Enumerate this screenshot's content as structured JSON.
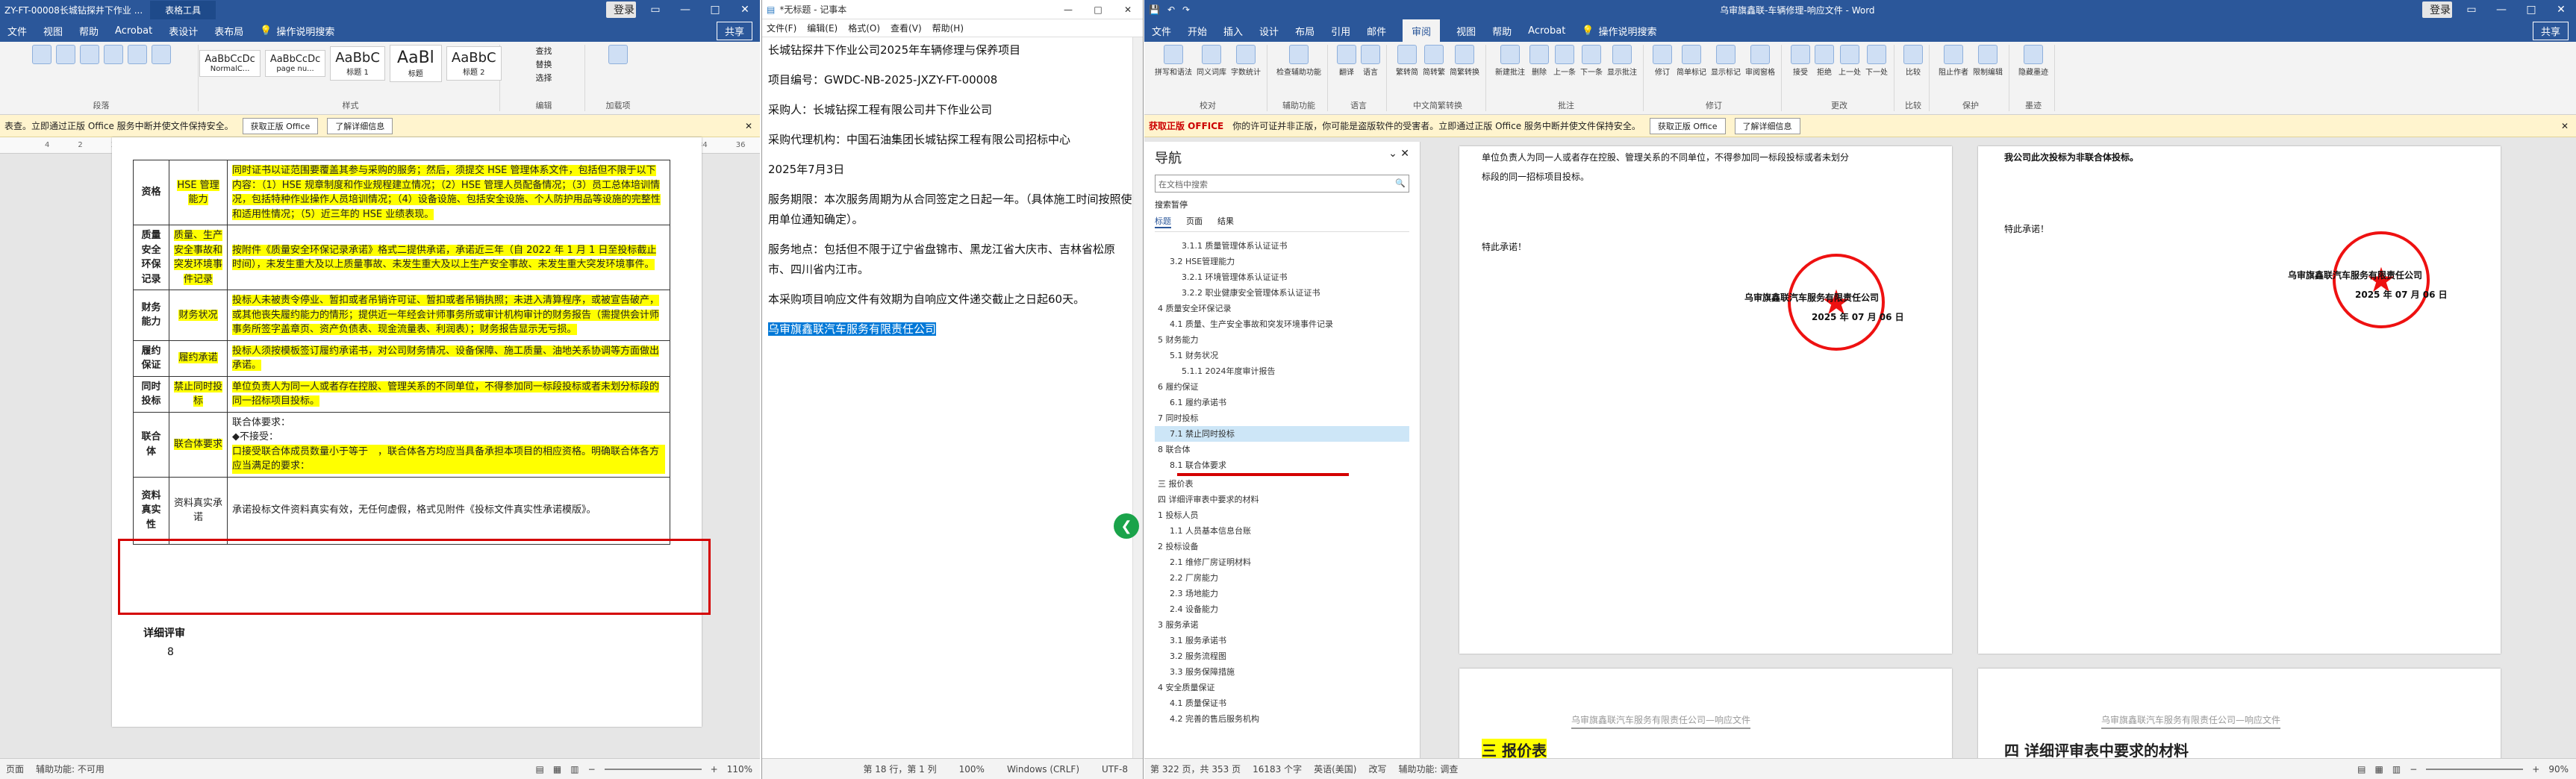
{
  "word1": {
    "title": "ZY-FT-00008长城钻探井下作业 ...",
    "context_tab": "表格工具",
    "signin": "登录",
    "tabs": [
      "文件",
      "视图",
      "帮助",
      "Acrobat",
      "表设计",
      "表布局"
    ],
    "tell_me": "操作说明搜索",
    "share": "共享",
    "ribbon_groups": [
      "段落",
      "样式",
      "编辑",
      "加载项"
    ],
    "styles": [
      {
        "sample": "AaBbCcDc",
        "name": "NormalC..."
      },
      {
        "sample": "AaBbCcDc",
        "name": "page nu..."
      },
      {
        "sample": "AaBbC",
        "name": "标题 1"
      },
      {
        "sample": "AaBl",
        "name": "标题"
      },
      {
        "sample": "AaBbC",
        "name": "标题 2"
      }
    ],
    "edit_items": [
      "查找",
      "替换",
      "选择"
    ],
    "msgbar": {
      "text": "表查。立即通过正版 Office 服务中断并使文件保持安全。",
      "btn1": "获取正版 Office",
      "btn2": "了解详细信息"
    },
    "table_rows": [
      {
        "c1": "资格",
        "c2": "HSE 管理能力",
        "c3": "同时证书以证范围要覆盖其参与采购的服务；然后，须提交 HSE 管理体系文件，包括但不限于以下内容：（1）HSE 规章制度和作业规程建立情况；（2）HSE 管理人员配备情况；（3）员工总体培训情况，包括特种作业操作人员培训情况；（4）设备设施、包括安全设施、个人防护用品等设施的完整性和适用性情况；（5）近三年的 HSE 业绩表现。"
      },
      {
        "c1": "质量安全环保记录",
        "c2": "质量、生产安全事故和突发环境事件记录",
        "c3": "按附件《质量安全环保记录承诺》格式二提供承诺，承诺近三年（自 2022 年 1 月 1 日至投标截止时间），未发生重大及以上质量事故、未发生重大及以上生产安全事故、未发生重大突发环境事件。"
      },
      {
        "c1": "财务能力",
        "c2": "财务状况",
        "c3": "投标人未被责令停业、暂扣或者吊销许可证、暂扣或者吊销执照；未进入清算程序，或被宣告破产，或其他丧失履约能力的情形；提供近一年经会计师事务所或审计机构审计的财务报告（需提供会计师事务所签字盖章页、资产负债表、现金流量表、利润表）；财务报告显示无亏损。"
      },
      {
        "c1": "履约保证",
        "c2": "履约承诺",
        "c3": "投标人须按模板签订履约承诺书，对公司财务情况、设备保障、施工质量、油地关系协调等方面做出承诺。"
      },
      {
        "c1": "同时投标",
        "c2": "禁止同时投标",
        "c3": "单位负责人为同一人或者存在控股、管理关系的不同单位，不得参加同一标段投标或者未划分标段的同一招标项目投标。"
      },
      {
        "c1": "联合体",
        "c2": "联合体要求",
        "c3a": "联合体要求：",
        "c3b": "◆不接受：",
        "c3c": "口接受联合体成员数量小于等于　，联合体各方均应当具备承担本项目的相应资格。明确联合体各方应当满足的要求："
      },
      {
        "c1": "资料真实性",
        "c2": "资料真实承诺",
        "c3": "承诺投标文件资料真实有效，无任何虚假，格式见附件《投标文件真实性承诺模版》。"
      }
    ],
    "below_table": "详细评审",
    "page_num": "8",
    "status_left": [
      "页面",
      "辅助功能: 不可用"
    ],
    "zoom": "110%"
  },
  "notepad": {
    "title": "*无标题 - 记事本",
    "menu": [
      "文件(F)",
      "编辑(E)",
      "格式(O)",
      "查看(V)",
      "帮助(H)"
    ],
    "lines": [
      "长城钻探井下作业公司2025年车辆修理与保养项目",
      "项目编号：GWDC-NB-2025-JXZY-FT-00008",
      "采购人：长城钻探工程有限公司井下作业公司",
      "采购代理机构：中国石油集团长城钻探工程有限公司招标中心",
      "2025年7月3日",
      "服务期限：本次服务周期为从合同签定之日起一年。（具体施工时间按照使用单位通知确定）。",
      "服务地点：包括但不限于辽宁省盘锦市、黑龙江省大庆市、吉林省松原市、四川省内江市。",
      "本采购项目响应文件有效期为自响应文件递交截止之日起60天。"
    ],
    "selected": "乌审旗鑫联汽车服务有限责任公司",
    "status": [
      "第 18 行，第 1 列",
      "100%",
      "Windows (CRLF)",
      "UTF-8"
    ]
  },
  "word2": {
    "title": "乌审旗鑫联-车辆修理-响应文件 - Word",
    "signin": "登录",
    "tabs": [
      "文件",
      "开始",
      "插入",
      "设计",
      "布局",
      "引用",
      "邮件",
      "审阅",
      "视图",
      "帮助",
      "Acrobat"
    ],
    "active_tab": "审阅",
    "tell_me": "操作说明搜索",
    "share": "共享",
    "ribbon": [
      {
        "label": "校对",
        "items": [
          "拼写和语法",
          "同义词库",
          "字数统计"
        ]
      },
      {
        "label": "辅助功能",
        "items": [
          "检查辅助功能"
        ]
      },
      {
        "label": "语言",
        "items": [
          "翻译",
          "语言"
        ]
      },
      {
        "label": "中文简繁转换",
        "items": [
          "繁转简",
          "简转繁",
          "简繁转换"
        ]
      },
      {
        "label": "批注",
        "items": [
          "新建批注",
          "删除",
          "上一条",
          "下一条",
          "显示批注"
        ]
      },
      {
        "label": "修订",
        "items": [
          "修订",
          "简单标记",
          "显示标记",
          "审阅窗格"
        ]
      },
      {
        "label": "更改",
        "items": [
          "接受",
          "拒绝",
          "上一处",
          "下一处"
        ]
      },
      {
        "label": "比较",
        "items": [
          "比较"
        ]
      },
      {
        "label": "保护",
        "items": [
          "阻止作者",
          "限制编辑"
        ]
      },
      {
        "label": "墨迹",
        "items": [
          "隐藏墨迹"
        ]
      }
    ],
    "msgbar": {
      "badge": "获取正版 OFFICE",
      "text": "你的许可证并非正版，你可能是盗版软件的受害者。立即通过正版 Office 服务中断并使文件保持安全。",
      "btn1": "获取正版 Office",
      "btn2": "了解详细信息"
    },
    "nav": {
      "title": "导航",
      "search_placeholder": "在文档中搜索",
      "tabs": [
        "标题",
        "页面",
        "结果"
      ],
      "label_pause": "搜索暂停",
      "items": [
        "3.1.1 质量管理体系认证证书",
        "3.2 HSE管理能力",
        "3.2.1 环境管理体系认证证书",
        "3.2.2 职业健康安全管理体系认证证书",
        "4 质量安全环保记录",
        "4.1 质量、生产安全事故和突发环境事件记录",
        "5 财务能力",
        "5.1 财务状况",
        "5.1.1 2024年度审计报告",
        "6 履约保证",
        "6.1 履约承诺书",
        "7 同时投标",
        "7.1 禁止同时投标",
        "8 联合体",
        "8.1 联合体要求",
        "三 报价表",
        "四 详细评审表中要求的材料",
        "1 投标人员",
        "1.1 人员基本信息台账",
        "2 投标设备",
        "2.1 维修厂房证明材料",
        "2.2 厂房能力",
        "2.3 场地能力",
        "2.4 设备能力",
        "3 服务承诺",
        "3.1 服务承诺书",
        "3.2 服务流程图",
        "3.3 服务保障措施",
        "4 安全质量保证",
        "4.1 质量保证书",
        "4.2 完善的售后服务机构"
      ],
      "selected_index": 12
    },
    "page1_lines": [
      "单位负责人为同一人或者存在控股、管理关系的不同单位，不得参加同一标段投标或者未划分",
      "标段的同一招标项目投标。",
      "特此承诺！"
    ],
    "page2_lines": [
      "我公司此次投标为非联合体投标。",
      "特此承诺！"
    ],
    "signer": "乌审旗鑫联汽车服务有限责任公司",
    "date": "2025 年 07 月 06 日",
    "header_text": "乌审旗鑫联汽车服务有限责任公司—响应文件",
    "heading_left": "三 报价表",
    "heading_right": "四 详细评审表中要求的材料",
    "status": [
      "第 322 页，共 353 页",
      "16183 个字",
      "英语(美国)",
      "改写",
      "辅助功能: 调查"
    ],
    "zoom": "90%"
  }
}
